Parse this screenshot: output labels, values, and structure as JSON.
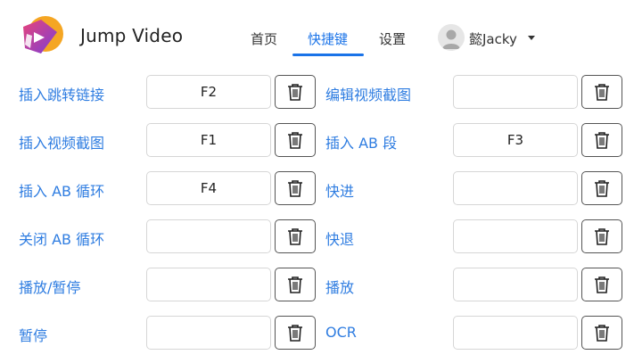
{
  "app": {
    "title": "Jump Video"
  },
  "nav": {
    "items": [
      {
        "label": "首页"
      },
      {
        "label": "快捷键"
      },
      {
        "label": "设置"
      }
    ],
    "active": "快捷键"
  },
  "user": {
    "name": "懿Jacky"
  },
  "colors": {
    "accent": "#1a73e8",
    "label": "#2f7de1"
  },
  "shortcuts": [
    {
      "label": "插入跳转链接",
      "key": "F2"
    },
    {
      "label": "编辑视频截图",
      "key": ""
    },
    {
      "label": "插入视频截图",
      "key": "F1"
    },
    {
      "label": "插入 AB 段",
      "key": "F3"
    },
    {
      "label": "插入 AB 循环",
      "key": "F4"
    },
    {
      "label": "快进",
      "key": ""
    },
    {
      "label": "关闭 AB 循环",
      "key": ""
    },
    {
      "label": "快退",
      "key": ""
    },
    {
      "label": "播放/暂停",
      "key": ""
    },
    {
      "label": "播放",
      "key": ""
    },
    {
      "label": "暂停",
      "key": ""
    },
    {
      "label": "OCR",
      "key": ""
    }
  ],
  "icons": {
    "delete": "trash-icon",
    "logo": "jump-video-logo-icon",
    "avatar": "user-avatar-icon"
  }
}
